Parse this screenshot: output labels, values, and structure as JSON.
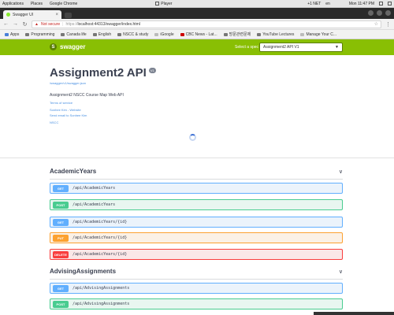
{
  "os_panel": {
    "applications": "Applications",
    "places": "Places",
    "chrome": "Google Chrome",
    "player": "Player",
    "status": "+1 NET",
    "lang": "en",
    "time": "Mon 11:47 PM"
  },
  "tab": {
    "title": "Swagger UI",
    "close": "×"
  },
  "address": {
    "not_secure": "Not secure",
    "scheme": "https://",
    "url": "localhost:44313/swagger/index.html"
  },
  "bookmarks": [
    "Apps",
    "Programming",
    "Canada life",
    "English",
    "NSCC & study",
    "iGoogle",
    "CBC News - Lat...",
    "방문관련문제",
    "YouTube Lectures",
    "Manage Your C..."
  ],
  "swagger": {
    "logo_letter": "S",
    "logo_text": "swagger",
    "select_label": "Select a spec",
    "select_value": "Assignment2 API V1"
  },
  "info": {
    "title": "Assignment2 API",
    "version": "V1",
    "spec_url": "/swagger/v1/swagger.json",
    "description": "Assignment2 NSCC Course Map Web API",
    "terms": "Terms of service",
    "contact_1": "Sonhee Kim - Website",
    "contact_2": "Send email to Sonhee Kim",
    "license": "NSCC"
  },
  "tags": [
    {
      "name": "AcademicYears",
      "chevron": "∨"
    },
    {
      "name": "AdvisingAssignments",
      "chevron": "∨"
    }
  ],
  "operations": [
    {
      "method": "GET",
      "path": "/api/AcademicYears"
    },
    {
      "method": "POST",
      "path": "/api/AcademicYears"
    },
    {
      "method": "GET",
      "path": "/api/AcademicYears/{id}"
    },
    {
      "method": "PUT",
      "path": "/api/AcademicYears/{id}"
    },
    {
      "method": "DELETE",
      "path": "/api/AcademicYears/{id}"
    },
    {
      "method": "GET",
      "path": "/api/AdvisingAssignments"
    },
    {
      "method": "POST",
      "path": "/api/AdvisingAssignments"
    }
  ]
}
